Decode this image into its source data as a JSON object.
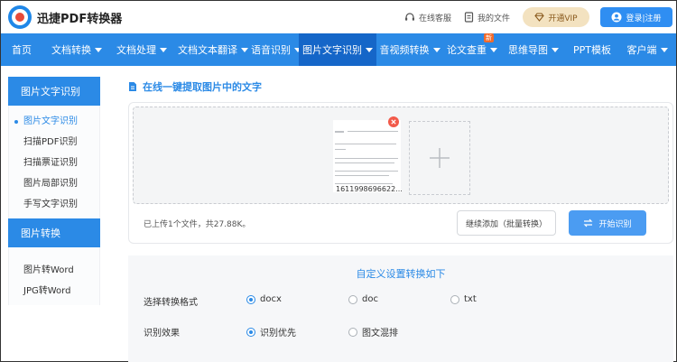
{
  "header": {
    "app_name": "迅捷PDF转换器",
    "links": [
      {
        "label": "在线客服",
        "icon": "headset-icon"
      },
      {
        "label": "我的文件",
        "icon": "file-icon"
      }
    ],
    "vip_label": "开通VIP",
    "login_label": "登录|注册"
  },
  "nav": {
    "items": [
      {
        "label": "首页",
        "dropdown": false
      },
      {
        "label": "文档转换",
        "dropdown": true
      },
      {
        "label": "文档处理",
        "dropdown": true
      },
      {
        "label": "文档文本翻译",
        "dropdown": true
      },
      {
        "label": "语音识别",
        "dropdown": true
      },
      {
        "label": "图片文字识别",
        "dropdown": true,
        "active": true
      },
      {
        "label": "音视频转换",
        "dropdown": true
      },
      {
        "label": "论文查重",
        "dropdown": true,
        "badge": "新"
      },
      {
        "label": "思维导图",
        "dropdown": true
      },
      {
        "label": "PPT模板",
        "dropdown": false
      },
      {
        "label": "客户端",
        "dropdown": true
      }
    ]
  },
  "sidebar": {
    "group1_title": "图片文字识别",
    "group1_items": [
      "图片文字识别",
      "扫描PDF识别",
      "扫描票证识别",
      "图片局部识别",
      "手写文字识别"
    ],
    "group2_title": "图片转换",
    "group2_items": [
      "图片转Word",
      "JPG转Word"
    ]
  },
  "main": {
    "title": "在线一键提取图片中的文字",
    "file_name": "1611998696622...",
    "upload_status": "已上传1个文件，共27.88K。",
    "continue_label": "继续添加（批量转换）",
    "start_label": "开始识别"
  },
  "settings": {
    "title": "自定义设置转换如下",
    "format_label": "选择转换格式",
    "format_options": [
      "docx",
      "doc",
      "txt"
    ],
    "format_selected": "docx",
    "effect_label": "识别效果",
    "effect_options": [
      "识别优先",
      "图文混排"
    ],
    "effect_selected": "识别优先"
  },
  "colors": {
    "brand_blue": "#2b8ae6",
    "nav_active": "#1566c8",
    "vip_bg": "#f3e2c0",
    "badge_orange": "#f36b2c",
    "close_red": "#f25a4a"
  }
}
